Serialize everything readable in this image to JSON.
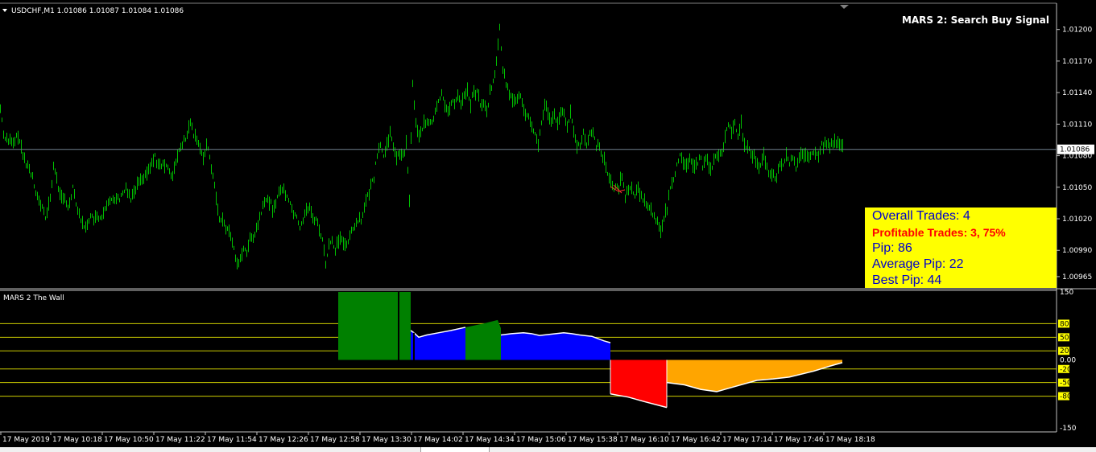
{
  "window": {
    "symbol_header": "USDCHF,M1  1.01086 1.01087 1.01084 1.01086",
    "signal_title": "MARS 2: Search Buy Signal",
    "current_price_label": "1.01086",
    "indicator_title": "MARS 2 The Wall"
  },
  "info_box": {
    "overall_trades": "Overall Trades: 4",
    "profitable_trades": "Profitable Trades: 3, 75%",
    "pip": "Pip: 86",
    "average_pip": "Average Pip: 22",
    "best_pip": "Best Pip: 44"
  },
  "colors": {
    "background": "#000000",
    "candles": "#00c000",
    "grid_line": "#808080",
    "level_line": "#cccc00",
    "green_fill": "#008000",
    "blue_fill": "#0000ff",
    "red_fill": "#ff0000",
    "orange_fill": "#ffa500",
    "info_bg": "#ffff00",
    "info_text": "#0000cc",
    "info_highlight": "#ff0000"
  },
  "chart_data": [
    {
      "type": "line",
      "name_visible": "USDCHF,M1",
      "ylim": [
        1.00955,
        1.01225
      ],
      "y_ticks": [
        "1.01200",
        "1.01170",
        "1.01140",
        "1.01110",
        "1.01080",
        "1.01050",
        "1.01020",
        "1.00990",
        "1.00965"
      ],
      "y_tick_values": [
        1.012,
        1.0117,
        1.0114,
        1.0111,
        1.0108,
        1.0105,
        1.0102,
        1.0099,
        1.00965
      ],
      "current_price": 1.01086,
      "x": [
        "17 May 2019",
        "17 May 10:18",
        "17 May 10:50",
        "17 May 11:22",
        "17 May 11:54",
        "17 May 12:26",
        "17 May 12:58",
        "17 May 13:30",
        "17 May 14:02",
        "17 May 14:34",
        "17 May 15:06",
        "17 May 15:38",
        "17 May 16:10",
        "17 May 16:42",
        "17 May 17:14",
        "17 May 17:46",
        "17 May 18:18"
      ],
      "price_path": [
        [
          0,
          1.01125
        ],
        [
          4,
          1.011
        ],
        [
          10,
          1.01095
        ],
        [
          16,
          1.0109
        ],
        [
          22,
          1.011
        ],
        [
          28,
          1.0108
        ],
        [
          34,
          1.0107
        ],
        [
          40,
          1.0106
        ],
        [
          46,
          1.0104
        ],
        [
          52,
          1.0103
        ],
        [
          56,
          1.0102
        ],
        [
          62,
          1.0104
        ],
        [
          66,
          1.0107
        ],
        [
          72,
          1.0105
        ],
        [
          78,
          1.0104
        ],
        [
          84,
          1.0103
        ],
        [
          90,
          1.0105
        ],
        [
          96,
          1.0103
        ],
        [
          100,
          1.0102
        ],
        [
          104,
          1.0101
        ],
        [
          110,
          1.0102
        ],
        [
          118,
          1.0102
        ],
        [
          126,
          1.0102
        ],
        [
          132,
          1.0103
        ],
        [
          138,
          1.0104
        ],
        [
          144,
          1.0104
        ],
        [
          150,
          1.0104
        ],
        [
          156,
          1.0105
        ],
        [
          162,
          1.0104
        ],
        [
          168,
          1.0105
        ],
        [
          174,
          1.0106
        ],
        [
          180,
          1.0106
        ],
        [
          186,
          1.0107
        ],
        [
          192,
          1.0108
        ],
        [
          196,
          1.0107
        ],
        [
          202,
          1.0107
        ],
        [
          208,
          1.0107
        ],
        [
          214,
          1.0106
        ],
        [
          220,
          1.0108
        ],
        [
          226,
          1.0109
        ],
        [
          232,
          1.011
        ],
        [
          236,
          1.0111
        ],
        [
          240,
          1.011
        ],
        [
          246,
          1.0109
        ],
        [
          252,
          1.0108
        ],
        [
          256,
          1.0109
        ],
        [
          260,
          1.0108
        ],
        [
          264,
          1.0106
        ],
        [
          268,
          1.0104
        ],
        [
          272,
          1.0102
        ],
        [
          276,
          1.0102
        ],
        [
          280,
          1.0101
        ],
        [
          284,
          1.0101
        ],
        [
          290,
          1.0099
        ],
        [
          294,
          1.0098
        ],
        [
          298,
          1.0098
        ],
        [
          302,
          1.0099
        ],
        [
          306,
          1.0099
        ],
        [
          310,
          1.01
        ],
        [
          314,
          1.01
        ],
        [
          318,
          1.0101
        ],
        [
          322,
          1.0102
        ],
        [
          326,
          1.0103
        ],
        [
          332,
          1.0104
        ],
        [
          338,
          1.0103
        ],
        [
          344,
          1.0104
        ],
        [
          350,
          1.0105
        ],
        [
          356,
          1.0104
        ],
        [
          362,
          1.0103
        ],
        [
          368,
          1.0102
        ],
        [
          372,
          1.0101
        ],
        [
          376,
          1.0102
        ],
        [
          380,
          1.0103
        ],
        [
          384,
          1.0103
        ],
        [
          388,
          1.0102
        ],
        [
          392,
          1.0102
        ],
        [
          396,
          1.0101
        ],
        [
          400,
          1.01
        ],
        [
          404,
          1.00975
        ],
        [
          408,
          1.00995
        ],
        [
          412,
          1.01
        ],
        [
          416,
          1.0099
        ],
        [
          420,
          1.01
        ],
        [
          424,
          1.01
        ],
        [
          428,
          1.00995
        ],
        [
          432,
          1.01
        ],
        [
          436,
          1.0101
        ],
        [
          440,
          1.0101
        ],
        [
          444,
          1.0102
        ],
        [
          448,
          1.0102
        ],
        [
          452,
          1.0103
        ],
        [
          456,
          1.0104
        ],
        [
          460,
          1.0105
        ],
        [
          464,
          1.0106
        ],
        [
          468,
          1.0108
        ],
        [
          472,
          1.0109
        ],
        [
          476,
          1.0108
        ],
        [
          480,
          1.0109
        ],
        [
          484,
          1.011
        ],
        [
          488,
          1.0109
        ],
        [
          492,
          1.0108
        ],
        [
          496,
          1.0108
        ],
        [
          500,
          1.0108
        ],
        [
          504,
          1.0109
        ],
        [
          508,
          1.0104
        ],
        [
          512,
          1.0115
        ],
        [
          516,
          1.0111
        ],
        [
          520,
          1.011
        ],
        [
          526,
          1.0111
        ],
        [
          532,
          1.0111
        ],
        [
          536,
          1.0111
        ],
        [
          540,
          1.0112
        ],
        [
          544,
          1.0113
        ],
        [
          548,
          1.0114
        ],
        [
          552,
          1.0113
        ],
        [
          556,
          1.0112
        ],
        [
          560,
          1.0113
        ],
        [
          564,
          1.0113
        ],
        [
          568,
          1.0114
        ],
        [
          572,
          1.0113
        ],
        [
          576,
          1.0114
        ],
        [
          580,
          1.0114
        ],
        [
          584,
          1.0113
        ],
        [
          588,
          1.0114
        ],
        [
          592,
          1.0114
        ],
        [
          596,
          1.0113
        ],
        [
          600,
          1.0113
        ],
        [
          604,
          1.0112
        ],
        [
          608,
          1.0114
        ],
        [
          612,
          1.0115
        ],
        [
          616,
          1.0117
        ],
        [
          620,
          1.012
        ],
        [
          624,
          1.0116
        ],
        [
          628,
          1.0115
        ],
        [
          632,
          1.0114
        ],
        [
          636,
          1.0113
        ],
        [
          640,
          1.0113
        ],
        [
          644,
          1.0114
        ],
        [
          648,
          1.0113
        ],
        [
          652,
          1.0112
        ],
        [
          656,
          1.0112
        ],
        [
          660,
          1.0111
        ],
        [
          664,
          1.011
        ],
        [
          668,
          1.0109
        ],
        [
          672,
          1.0111
        ],
        [
          676,
          1.0113
        ],
        [
          680,
          1.0112
        ],
        [
          684,
          1.0111
        ],
        [
          688,
          1.0112
        ],
        [
          692,
          1.0111
        ],
        [
          696,
          1.0112
        ],
        [
          700,
          1.0112
        ],
        [
          704,
          1.0111
        ],
        [
          708,
          1.0112
        ],
        [
          712,
          1.011
        ],
        [
          716,
          1.0109
        ],
        [
          720,
          1.0109
        ],
        [
          724,
          1.011
        ],
        [
          728,
          1.0109
        ],
        [
          732,
          1.011
        ],
        [
          736,
          1.011
        ],
        [
          740,
          1.0109
        ],
        [
          744,
          1.0109
        ],
        [
          748,
          1.0108
        ],
        [
          752,
          1.0107
        ],
        [
          756,
          1.0106
        ],
        [
          760,
          1.0105
        ],
        [
          764,
          1.0105
        ],
        [
          768,
          1.0105
        ],
        [
          772,
          1.0106
        ],
        [
          776,
          1.0104
        ],
        [
          780,
          1.0105
        ],
        [
          784,
          1.0105
        ],
        [
          788,
          1.0104
        ],
        [
          792,
          1.0105
        ],
        [
          796,
          1.0104
        ],
        [
          800,
          1.0104
        ],
        [
          804,
          1.0103
        ],
        [
          808,
          1.0103
        ],
        [
          812,
          1.0102
        ],
        [
          816,
          1.0102
        ],
        [
          820,
          1.0101
        ],
        [
          824,
          1.0102
        ],
        [
          828,
          1.0103
        ],
        [
          832,
          1.0105
        ],
        [
          836,
          1.0106
        ],
        [
          840,
          1.0107
        ],
        [
          844,
          1.0108
        ],
        [
          848,
          1.0107
        ],
        [
          852,
          1.0107
        ],
        [
          856,
          1.0108
        ],
        [
          860,
          1.0107
        ],
        [
          864,
          1.0107
        ],
        [
          868,
          1.0108
        ],
        [
          872,
          1.0107
        ],
        [
          876,
          1.0108
        ],
        [
          880,
          1.0107
        ],
        [
          884,
          1.0107
        ],
        [
          888,
          1.0108
        ],
        [
          892,
          1.0108
        ],
        [
          896,
          1.0108
        ],
        [
          900,
          1.011
        ],
        [
          904,
          1.0111
        ],
        [
          908,
          1.011
        ],
        [
          912,
          1.0111
        ],
        [
          916,
          1.011
        ],
        [
          920,
          1.0111
        ],
        [
          924,
          1.0109
        ],
        [
          928,
          1.0109
        ],
        [
          932,
          1.0108
        ],
        [
          936,
          1.0108
        ],
        [
          940,
          1.0107
        ],
        [
          944,
          1.0107
        ],
        [
          948,
          1.0108
        ],
        [
          952,
          1.0107
        ],
        [
          956,
          1.0106
        ],
        [
          960,
          1.0106
        ],
        [
          964,
          1.0106
        ],
        [
          968,
          1.0107
        ],
        [
          972,
          1.0107
        ],
        [
          976,
          1.0108
        ],
        [
          980,
          1.0107
        ],
        [
          984,
          1.0108
        ],
        [
          988,
          1.0107
        ],
        [
          992,
          1.0108
        ],
        [
          996,
          1.0108
        ],
        [
          1000,
          1.0108
        ],
        [
          1004,
          1.0108
        ],
        [
          1008,
          1.0108
        ],
        [
          1012,
          1.0108
        ],
        [
          1016,
          1.0108
        ],
        [
          1020,
          1.0109
        ],
        [
          1024,
          1.0109
        ],
        [
          1028,
          1.0109
        ],
        [
          1032,
          1.0109
        ],
        [
          1036,
          1.01095
        ],
        [
          1040,
          1.0109
        ],
        [
          1044,
          1.0109
        ],
        [
          1048,
          1.01086
        ]
      ]
    },
    {
      "type": "area",
      "name_visible": "MARS 2 The Wall",
      "ylim": [
        -150,
        150
      ],
      "y_ticks": [
        "150",
        "80",
        "50",
        "20",
        "0.00",
        "-20",
        "-50",
        "-80",
        "-150"
      ],
      "y_tick_values": [
        150,
        80,
        50,
        20,
        0,
        -20,
        -50,
        -80,
        -150
      ],
      "levels": [
        80,
        50,
        20,
        -20,
        -50,
        -80
      ],
      "segments": [
        {
          "color": "green",
          "x_range": [
            420,
            510
          ],
          "values": [
            [
              420,
              150
            ],
            [
              510,
              150
            ]
          ]
        },
        {
          "color": "blue",
          "x_range": [
            510,
            578
          ],
          "values": [
            [
              510,
              65
            ],
            [
              514,
              60
            ],
            [
              520,
              50
            ],
            [
              530,
              55
            ],
            [
              545,
              60
            ],
            [
              560,
              65
            ],
            [
              578,
              72
            ]
          ]
        },
        {
          "color": "green",
          "x_range": [
            578,
            622
          ],
          "values": [
            [
              578,
              72
            ],
            [
              600,
              80
            ],
            [
              618,
              88
            ],
            [
              622,
              70
            ]
          ]
        },
        {
          "color": "blue",
          "x_range": [
            622,
            758
          ],
          "values": [
            [
              622,
              55
            ],
            [
              635,
              58
            ],
            [
              650,
              60
            ],
            [
              660,
              58
            ],
            [
              670,
              54
            ],
            [
              680,
              56
            ],
            [
              690,
              58
            ],
            [
              700,
              60
            ],
            [
              710,
              58
            ],
            [
              720,
              55
            ],
            [
              735,
              52
            ],
            [
              750,
              42
            ],
            [
              758,
              38
            ]
          ]
        },
        {
          "color": "red",
          "x_range": [
            758,
            828
          ],
          "values": [
            [
              758,
              -75
            ],
            [
              780,
              -82
            ],
            [
              800,
              -92
            ],
            [
              828,
              -105
            ]
          ]
        },
        {
          "color": "orange",
          "x_range": [
            828,
            1046
          ],
          "values": [
            [
              828,
              -50
            ],
            [
              850,
              -55
            ],
            [
              870,
              -65
            ],
            [
              890,
              -70
            ],
            [
              910,
              -60
            ],
            [
              940,
              -45
            ],
            [
              960,
              -42
            ],
            [
              980,
              -38
            ],
            [
              1010,
              -25
            ],
            [
              1030,
              -14
            ],
            [
              1046,
              -6
            ]
          ]
        }
      ]
    }
  ]
}
